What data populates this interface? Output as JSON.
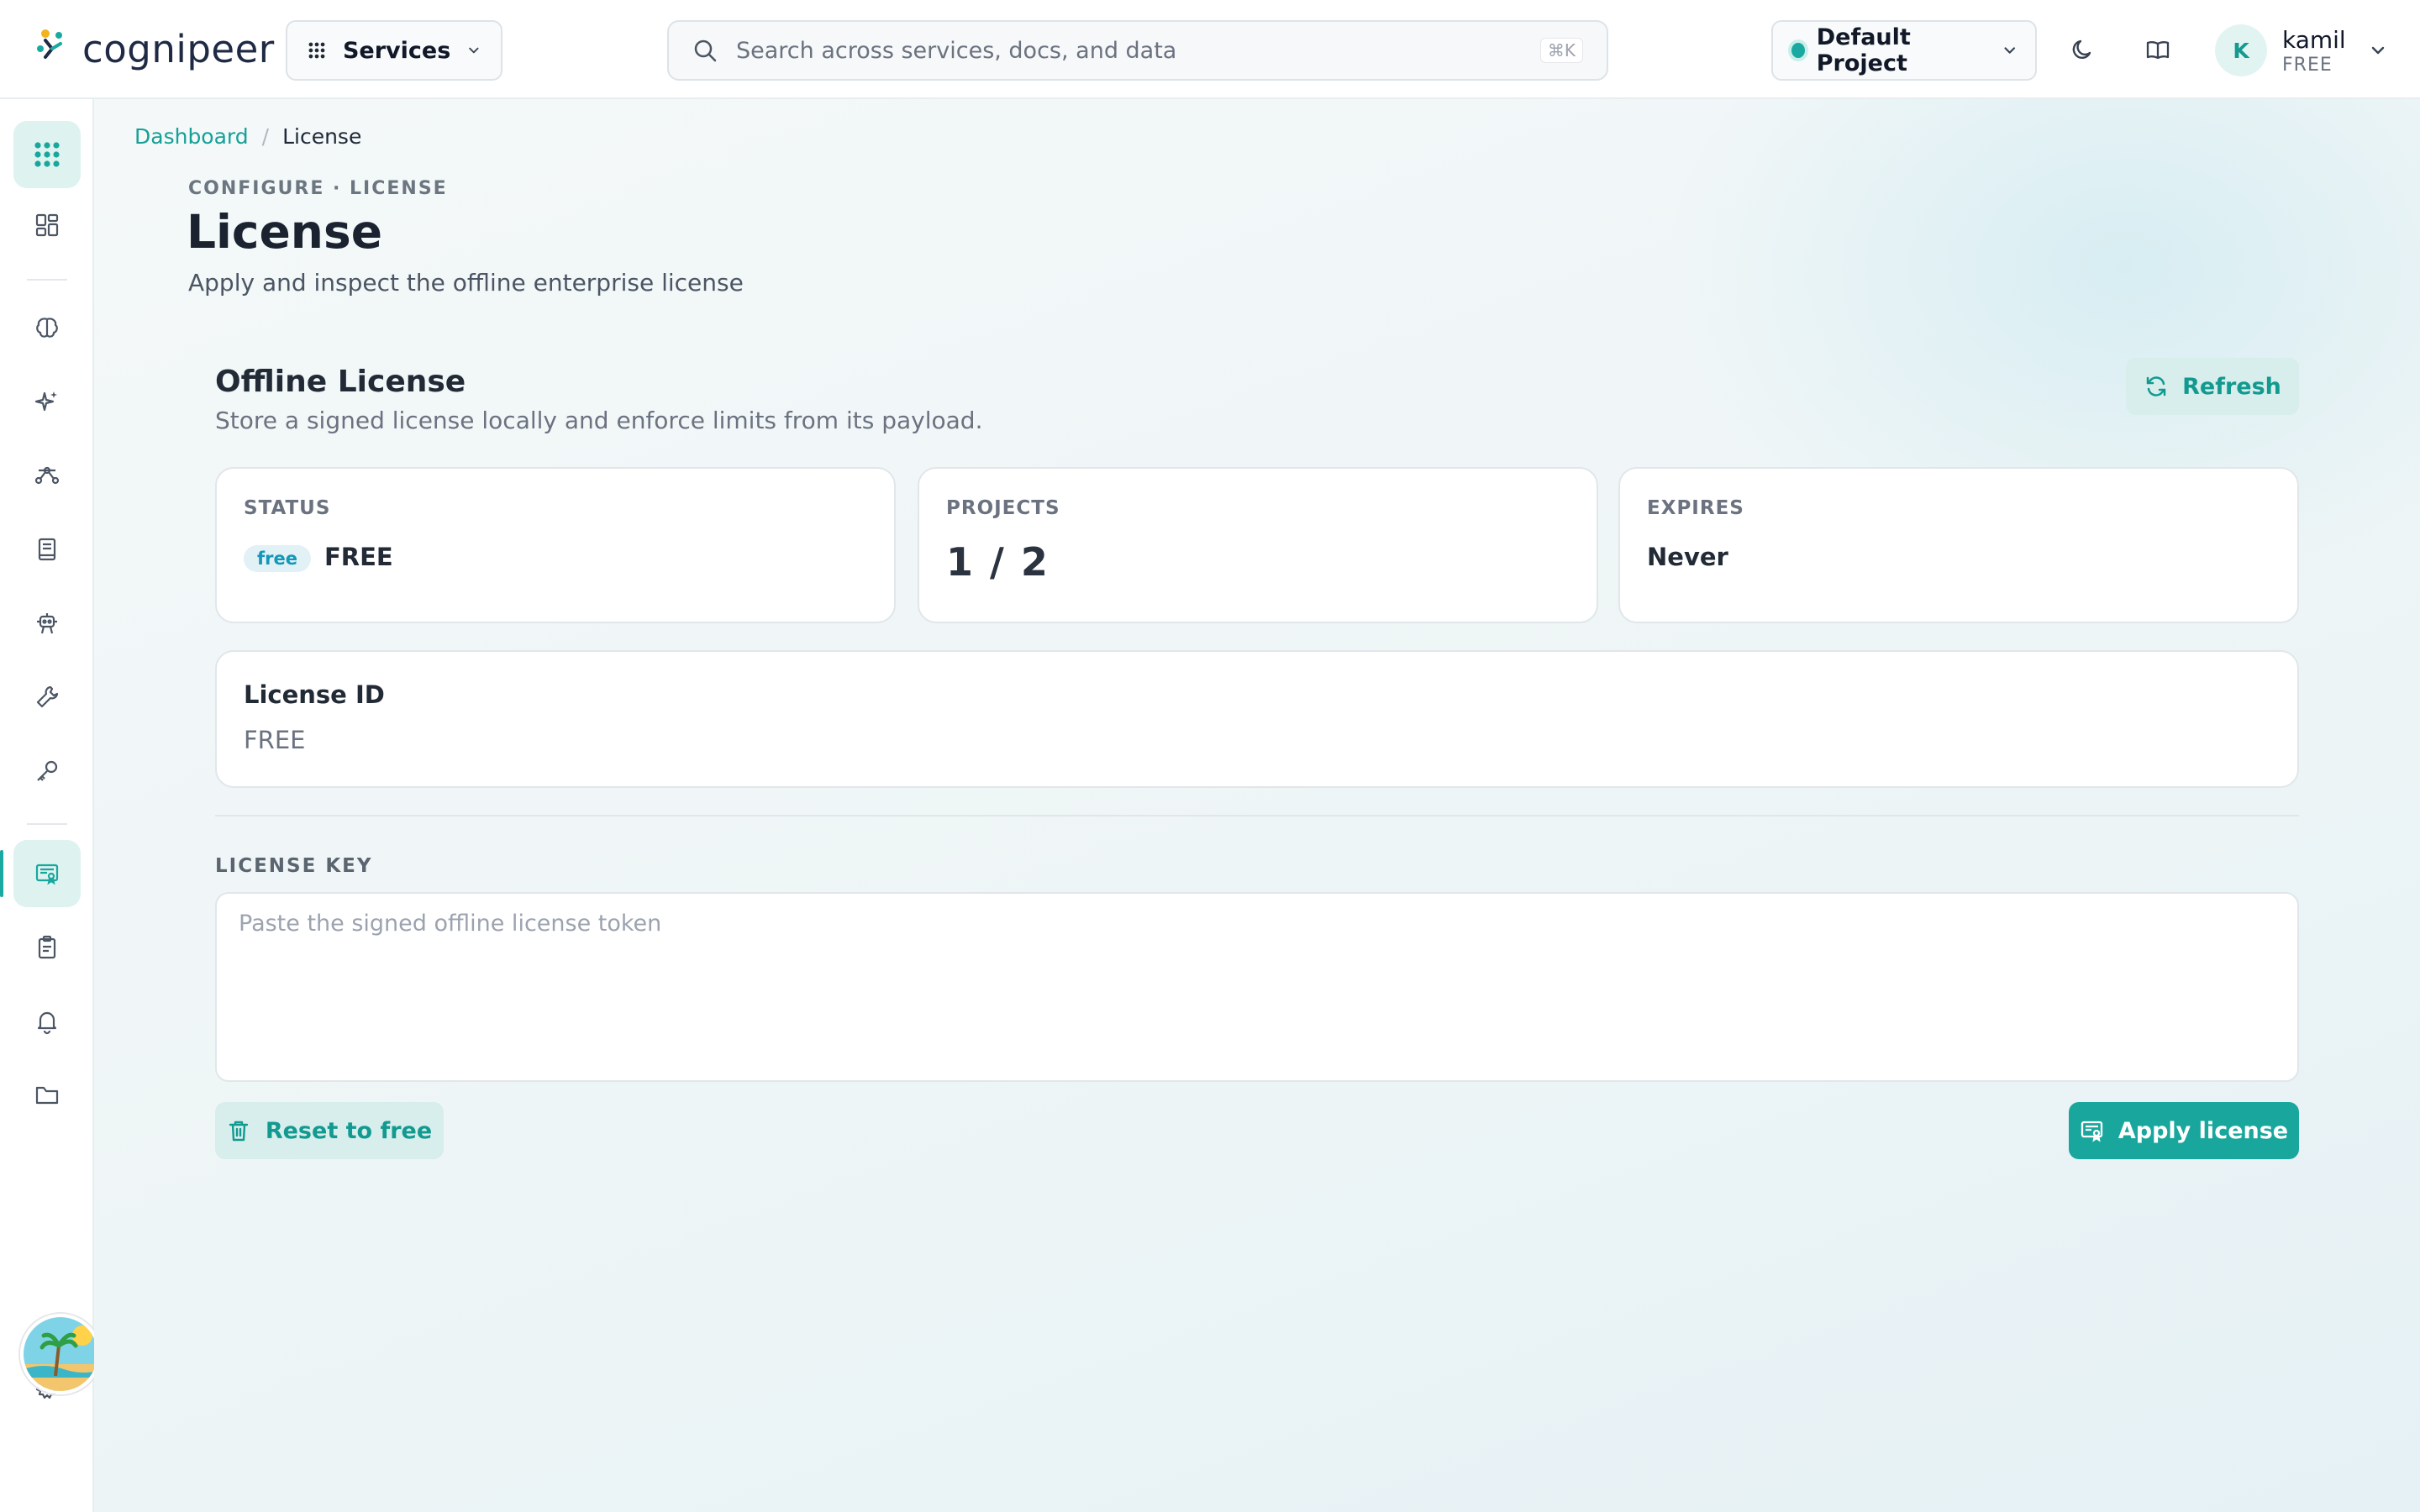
{
  "brand": {
    "name": "cognipeer"
  },
  "topbar": {
    "services_label": "Services",
    "search_placeholder": "Search across services, docs, and data",
    "search_shortcut": "⌘K",
    "project_name": "Default Project",
    "user": {
      "initial": "K",
      "name": "kamil",
      "plan": "FREE"
    }
  },
  "sidebar": {
    "items": [
      {
        "icon": "apps-grid-icon",
        "active": false
      },
      {
        "icon": "dashboard-icon",
        "active": false
      },
      {
        "icon": "brain-icon",
        "active": false
      },
      {
        "icon": "sparkles-icon",
        "active": false
      },
      {
        "icon": "route-icon",
        "active": false
      },
      {
        "icon": "book-icon",
        "active": false
      },
      {
        "icon": "robot-icon",
        "active": false
      },
      {
        "icon": "tools-icon",
        "active": false
      },
      {
        "icon": "key-icon",
        "active": false
      },
      {
        "icon": "license-icon",
        "active": true
      },
      {
        "icon": "clipboard-icon",
        "active": false
      },
      {
        "icon": "bell-icon",
        "active": false
      },
      {
        "icon": "folder-icon",
        "active": false
      },
      {
        "icon": "settings-icon",
        "active": false
      }
    ]
  },
  "breadcrumb": {
    "parent": "Dashboard",
    "separator": "/",
    "current": "License"
  },
  "page": {
    "eyebrow": "CONFIGURE · LICENSE",
    "title": "License",
    "subtitle": "Apply and inspect the offline enterprise license"
  },
  "card": {
    "title": "Offline License",
    "subtitle": "Store a signed license locally and enforce limits from its payload.",
    "refresh_label": "Refresh"
  },
  "stats": {
    "status": {
      "label": "STATUS",
      "badge": "free",
      "value": "FREE"
    },
    "projects": {
      "label": "PROJECTS",
      "value": "1 / 2"
    },
    "expires": {
      "label": "EXPIRES",
      "value": "Never"
    }
  },
  "license_id": {
    "label": "License ID",
    "value": "FREE"
  },
  "license_key": {
    "label": "LICENSE KEY",
    "placeholder": "Paste the signed offline license token",
    "value": ""
  },
  "actions": {
    "reset_label": "Reset to free",
    "apply_label": "Apply license"
  },
  "colors": {
    "accent": "#19a79d",
    "accent_soft": "#d7eeec",
    "badge_blue": "#1597b8"
  }
}
